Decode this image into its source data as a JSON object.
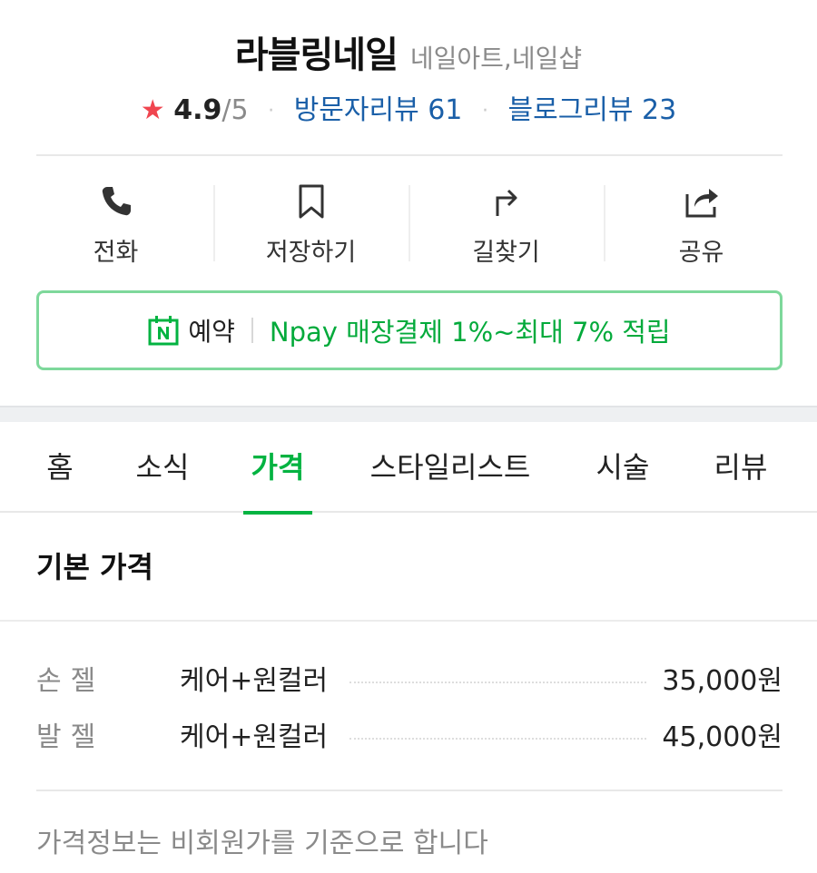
{
  "place": {
    "name": "라블링네일",
    "category": "네일아트,네일샵",
    "rating_star": "★",
    "rating": "4.9",
    "rating_max": "/5",
    "separator": "·",
    "visitor_reviews": "방문자리뷰 61",
    "blog_reviews": "블로그리뷰 23"
  },
  "actions": [
    {
      "label": "전화",
      "icon": "phone-icon"
    },
    {
      "label": "저장하기",
      "icon": "bookmark-icon"
    },
    {
      "label": "길찾기",
      "icon": "directions-icon"
    },
    {
      "label": "공유",
      "icon": "share-icon"
    }
  ],
  "booking": {
    "icon": "naver-booking-icon",
    "label": "예약",
    "promo": "Npay 매장결제 1%~최대 7% 적립",
    "colors": {
      "border": "#7ed89b",
      "promo_text": "#03aa3b"
    }
  },
  "tabs": [
    {
      "label": "홈",
      "active": false
    },
    {
      "label": "소식",
      "active": false
    },
    {
      "label": "가격",
      "active": true
    },
    {
      "label": "스타일리스트",
      "active": false
    },
    {
      "label": "시술",
      "active": false
    },
    {
      "label": "리뷰",
      "active": false
    }
  ],
  "price_section": {
    "title": "기본 가격",
    "items": [
      {
        "category": "손젤",
        "item": "케어+원컬러",
        "price": "35,000원"
      },
      {
        "category": "발젤",
        "item": "케어+원컬러",
        "price": "45,000원"
      }
    ],
    "notice": "가격정보는 비회원가를 기준으로 합니다"
  },
  "colors": {
    "accent_green": "#03b341",
    "link_blue": "#1a5fa8",
    "star_red": "#f0454f"
  }
}
